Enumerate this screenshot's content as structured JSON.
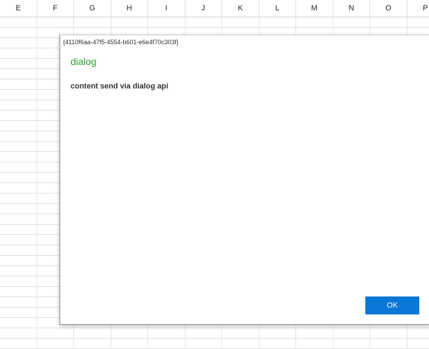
{
  "spreadsheet": {
    "columns": [
      "E",
      "F",
      "G",
      "H",
      "I",
      "J",
      "K",
      "L",
      "M",
      "N",
      "O",
      "P"
    ]
  },
  "dialog": {
    "id_text": "{4110f6aa-47f5-4554-b601-e6e4f70c303f}",
    "title": "dialog",
    "content": "content send via dialog api",
    "ok_label": "OK",
    "title_color": "#2aa02a",
    "button_color": "#0a78d4"
  }
}
